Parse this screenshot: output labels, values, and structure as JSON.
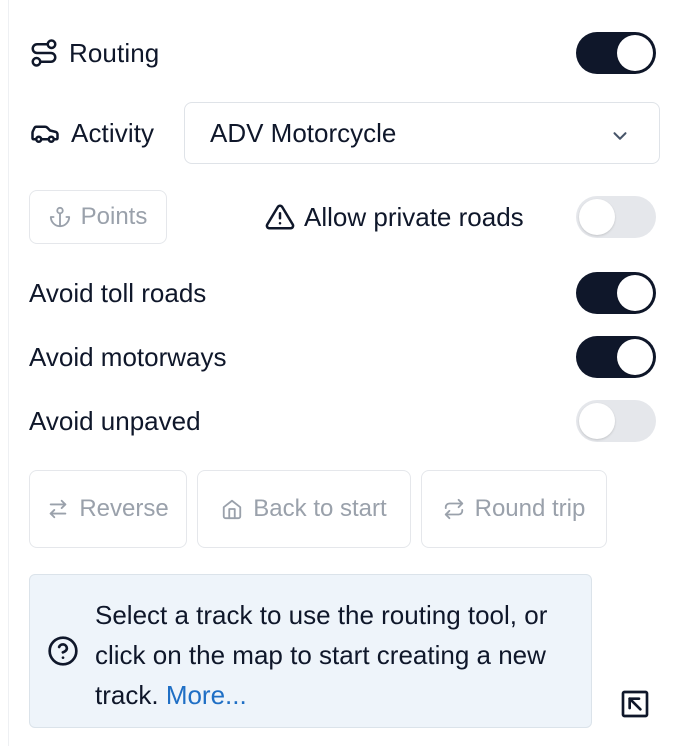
{
  "routing": {
    "label": "Routing",
    "enabled": true
  },
  "activity": {
    "label": "Activity",
    "selected": "ADV Motorcycle"
  },
  "points": {
    "label": "Points"
  },
  "allow_private": {
    "label": "Allow private roads",
    "enabled": false
  },
  "avoid_toll": {
    "label": "Avoid toll roads",
    "enabled": true
  },
  "avoid_motorways": {
    "label": "Avoid motorways",
    "enabled": true
  },
  "avoid_unpaved": {
    "label": "Avoid unpaved",
    "enabled": false
  },
  "actions": {
    "reverse": "Reverse",
    "back_to_start": "Back to start",
    "round_trip": "Round trip"
  },
  "info": {
    "text": "Select a track to use the routing tool, or click on the map to start creating a new track.",
    "more": "More..."
  },
  "colors": {
    "toggle_on": "#0f172a",
    "toggle_off": "#e5e7eb",
    "info_bg": "#eef4fa",
    "link": "#1f6fc5",
    "disabled_text": "#9aa1ab"
  },
  "icons": [
    "route-icon",
    "car-icon",
    "chevron-down-icon",
    "anchor-icon",
    "warning-icon",
    "swap-icon",
    "home-icon",
    "repeat-icon",
    "help-circle-icon",
    "collapse-arrow-icon"
  ]
}
